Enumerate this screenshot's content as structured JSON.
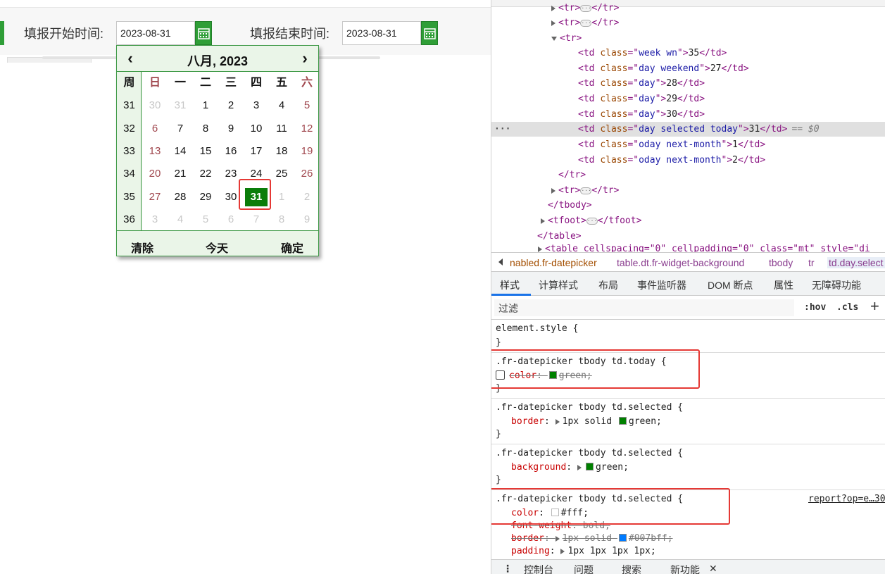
{
  "form": {
    "start_label": "填报开始时间:",
    "start_value": "2023-08-31",
    "end_label": "填报结束时间:",
    "end_value": "2023-08-31"
  },
  "datepicker": {
    "prev": "‹",
    "next": "›",
    "title": "八月, 2023",
    "week_header": "周",
    "weekday_headers": [
      "日",
      "一",
      "二",
      "三",
      "四",
      "五",
      "六"
    ],
    "weeks": [
      "31",
      "32",
      "33",
      "34",
      "35",
      "36"
    ],
    "rows": [
      [
        "30",
        "31",
        "1",
        "2",
        "3",
        "4",
        "5"
      ],
      [
        "6",
        "7",
        "8",
        "9",
        "10",
        "11",
        "12"
      ],
      [
        "13",
        "14",
        "15",
        "16",
        "17",
        "18",
        "19"
      ],
      [
        "20",
        "21",
        "22",
        "23",
        "24",
        "25",
        "26"
      ],
      [
        "27",
        "28",
        "29",
        "30",
        "31",
        "1",
        "2"
      ],
      [
        "3",
        "4",
        "5",
        "6",
        "7",
        "8",
        "9"
      ]
    ],
    "footer": {
      "clear": "清除",
      "today": "今天",
      "confirm": "确定"
    }
  },
  "dom": {
    "lines": [
      {
        "indent": 0,
        "tri": "r",
        "open": "<tr>",
        "close": "</tr>",
        "ell": true
      },
      {
        "indent": 0,
        "tri": "r",
        "open": "<tr>",
        "close": "</tr>",
        "ell": true
      },
      {
        "indent": 0,
        "tri": "d",
        "open": "<tr>"
      },
      {
        "indent": 1,
        "tag": "td",
        "attr": "class",
        "val": "week wn",
        "text": "35"
      },
      {
        "indent": 1,
        "tag": "td",
        "attr": "class",
        "val": "day weekend",
        "text": "27"
      },
      {
        "indent": 1,
        "tag": "td",
        "attr": "class",
        "val": "day",
        "text": "28"
      },
      {
        "indent": 1,
        "tag": "td",
        "attr": "class",
        "val": "day",
        "text": "29"
      },
      {
        "indent": 1,
        "tag": "td",
        "attr": "class",
        "val": "day",
        "text": "30"
      },
      {
        "indent": 1,
        "tag": "td",
        "attr": "class",
        "val": "day selected today",
        "text": "31",
        "hl": true,
        "suffix": "== $0"
      },
      {
        "indent": 1,
        "tag": "td",
        "attr": "class",
        "val": "oday next-month",
        "text": "1"
      },
      {
        "indent": 1,
        "tag": "td",
        "attr": "class",
        "val": "oday next-month",
        "text": "2"
      },
      {
        "indent": 0,
        "closeonly": "</tr>"
      },
      {
        "indent": 0,
        "tri": "r",
        "open": "<tr>",
        "close": "</tr>",
        "ell": true
      },
      {
        "indent": -1,
        "closeonly": "</tbody>"
      },
      {
        "indent": -1,
        "tri": "r",
        "open": "<tfoot>",
        "close": "</tfoot>",
        "ell": true
      },
      {
        "indent": -2,
        "closeonly": "</table>"
      }
    ],
    "last_partial": "<table cellspacing=\"0\" cellpadding=\"0\" class=\"mt\" style=\"di"
  },
  "breadcrumbs": [
    "nabled.fr-datepicker",
    "table.dt.fr-widget-background",
    "tbody",
    "tr",
    "td.day.select"
  ],
  "tabs": [
    "样式",
    "计算样式",
    "布局",
    "事件监听器",
    "DOM 断点",
    "属性",
    "无障碍功能"
  ],
  "filter": {
    "placeholder": "过滤",
    "hov": ":hov",
    "cls": ".cls",
    "plus": "+"
  },
  "rules": {
    "element_style": "element.style {",
    "r1_selector": ".fr-datepicker tbody td.today {",
    "r1_prop": "color",
    "r1_val": "green;",
    "r2_selector": ".fr-datepicker tbody td.selected {",
    "r2_prop": "border",
    "r2_val1": "1px solid",
    "r2_val2": "green;",
    "r3_selector": ".fr-datepicker tbody td.selected {",
    "r3_prop": "background",
    "r3_val": "green;",
    "r4_selector": ".fr-datepicker tbody td.selected {",
    "r4_source": "report?op=e…30",
    "r4_p1": "color",
    "r4_v1": "#fff;",
    "r4_p2": "font-weight",
    "r4_v2": "bold;",
    "r4_p3": "border",
    "r4_v3a": "1px solid",
    "r4_v3b": "#007bff;",
    "r4_p4": "padding",
    "r4_v4": "1px 1px 1px 1px;",
    "close": "}"
  },
  "colors": {
    "green": "#008000",
    "white": "#ffffff",
    "blue": "#007bff"
  },
  "drawer": {
    "menu": "⋮",
    "console": "控制台",
    "issues": "问题",
    "search": "搜索",
    "whatsnew": "新功能",
    "close": "✕"
  }
}
